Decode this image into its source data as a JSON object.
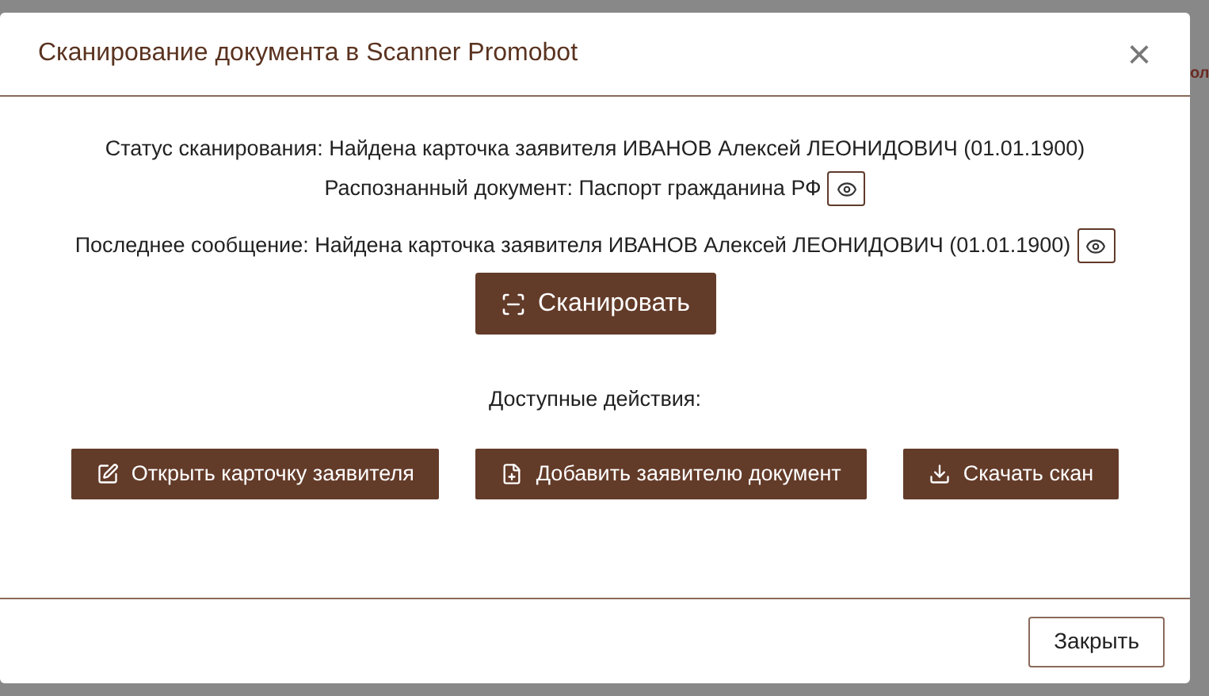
{
  "backdrop": {
    "text_fragment": "ол"
  },
  "dialog": {
    "title": "Сканирование документа в Scanner Promobot",
    "close_icon": "×",
    "status": "Статус сканирования: Найдена карточка заявителя ИВАНОВ Алексей ЛЕОНИДОВИЧ (01.01.1900)",
    "recognized": "Распознанный документ: Паспорт гражданина РФ",
    "last_message": "Последнее сообщение: Найдена карточка заявителя ИВАНОВ Алексей ЛЕОНИДОВИЧ (01.01.1900)",
    "scan_button": "Сканировать",
    "actions_label": "Доступные действия:",
    "actions": [
      {
        "kind": "edit",
        "label": "Открыть карточку заявителя"
      },
      {
        "kind": "add-file",
        "label": "Добавить заявителю документ"
      },
      {
        "kind": "download",
        "label": "Скачать скан"
      }
    ],
    "footer_button": "Закрыть"
  }
}
